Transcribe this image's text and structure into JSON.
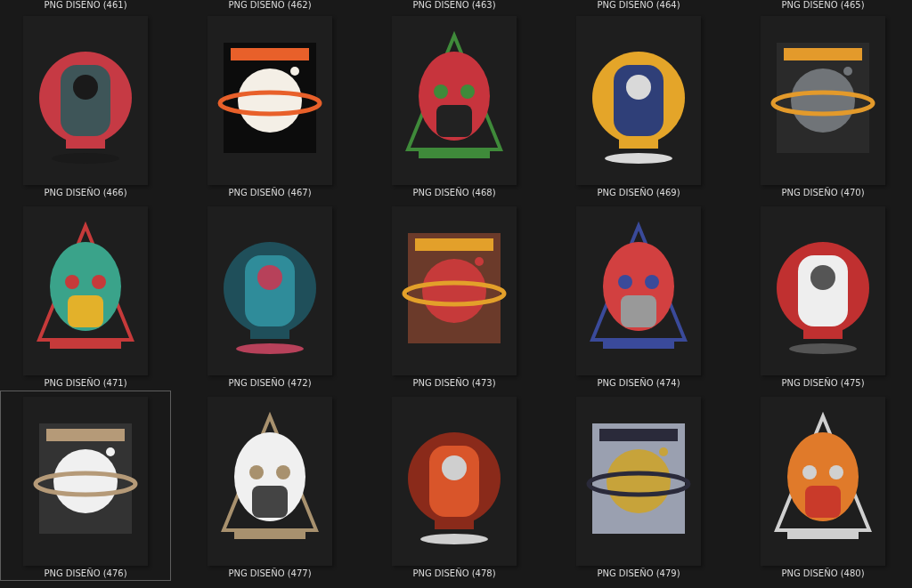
{
  "partial_row": [
    {
      "label": "PNG DISEÑO (461)"
    },
    {
      "label": "PNG DISEÑO (462)"
    },
    {
      "label": "PNG DISEÑO (463)"
    },
    {
      "label": "PNG DISEÑO (464)"
    },
    {
      "label": "PNG DISEÑO (465)"
    }
  ],
  "files": [
    {
      "label": "PNG DISEÑO (466)",
      "kind": "picture",
      "selected": false
    },
    {
      "label": "PNG DISEÑO (467)",
      "kind": "picture",
      "selected": false
    },
    {
      "label": "PNG DISEÑO (468)",
      "kind": "picture",
      "selected": false
    },
    {
      "label": "PNG DISEÑO (469)",
      "kind": "picture",
      "selected": false
    },
    {
      "label": "PNG DISEÑO (470)",
      "kind": "picture",
      "selected": false
    },
    {
      "label": "PNG DISEÑO (471)",
      "kind": "picture",
      "selected": false
    },
    {
      "label": "PNG DISEÑO (472)",
      "kind": "picture",
      "selected": false
    },
    {
      "label": "PNG DISEÑO (473)",
      "kind": "picture",
      "selected": false
    },
    {
      "label": "PNG DISEÑO (474)",
      "kind": "picture",
      "selected": false
    },
    {
      "label": "PNG DISEÑO (475)",
      "kind": "picture",
      "selected": false
    },
    {
      "label": "PNG DISEÑO (476)",
      "kind": "picture",
      "selected": true
    },
    {
      "label": "PNG DISEÑO (477)",
      "kind": "picture",
      "selected": false
    },
    {
      "label": "PNG DISEÑO (478)",
      "kind": "picture",
      "selected": false
    },
    {
      "label": "PNG DISEÑO (479)",
      "kind": "picture",
      "selected": false
    },
    {
      "label": "PNG DISEÑO (480)",
      "kind": "picture",
      "selected": false
    }
  ]
}
